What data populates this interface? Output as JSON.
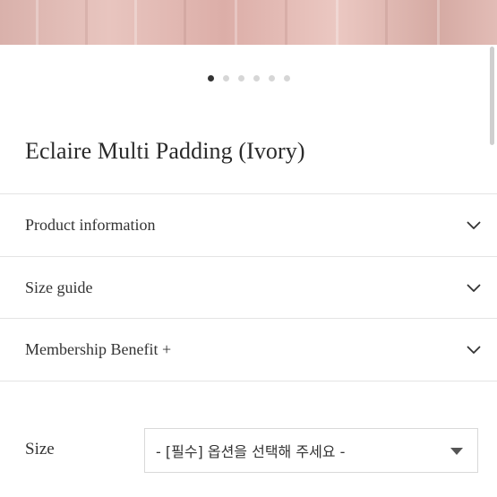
{
  "product": {
    "title": "Eclaire Multi Padding (Ivory)"
  },
  "carousel": {
    "total_slides": 6,
    "active_slide": 1
  },
  "accordion": [
    {
      "label": "Product information",
      "icon": "chevron-down-icon"
    },
    {
      "label": "Size guide",
      "icon": "chevron-down-icon"
    },
    {
      "label": "Membership Benefit +",
      "icon": "chevron-down-icon"
    }
  ],
  "options": {
    "size_label": "Size",
    "size_selected": "- [필수] 옵션을 선택해 주세요 -",
    "size_icon": "caret-down-icon"
  },
  "colors": {
    "hero_tint": "#dfb8b2",
    "active_dot": "#333333",
    "inactive_dot": "#d6d6d6",
    "divider": "#e4e4e4"
  }
}
